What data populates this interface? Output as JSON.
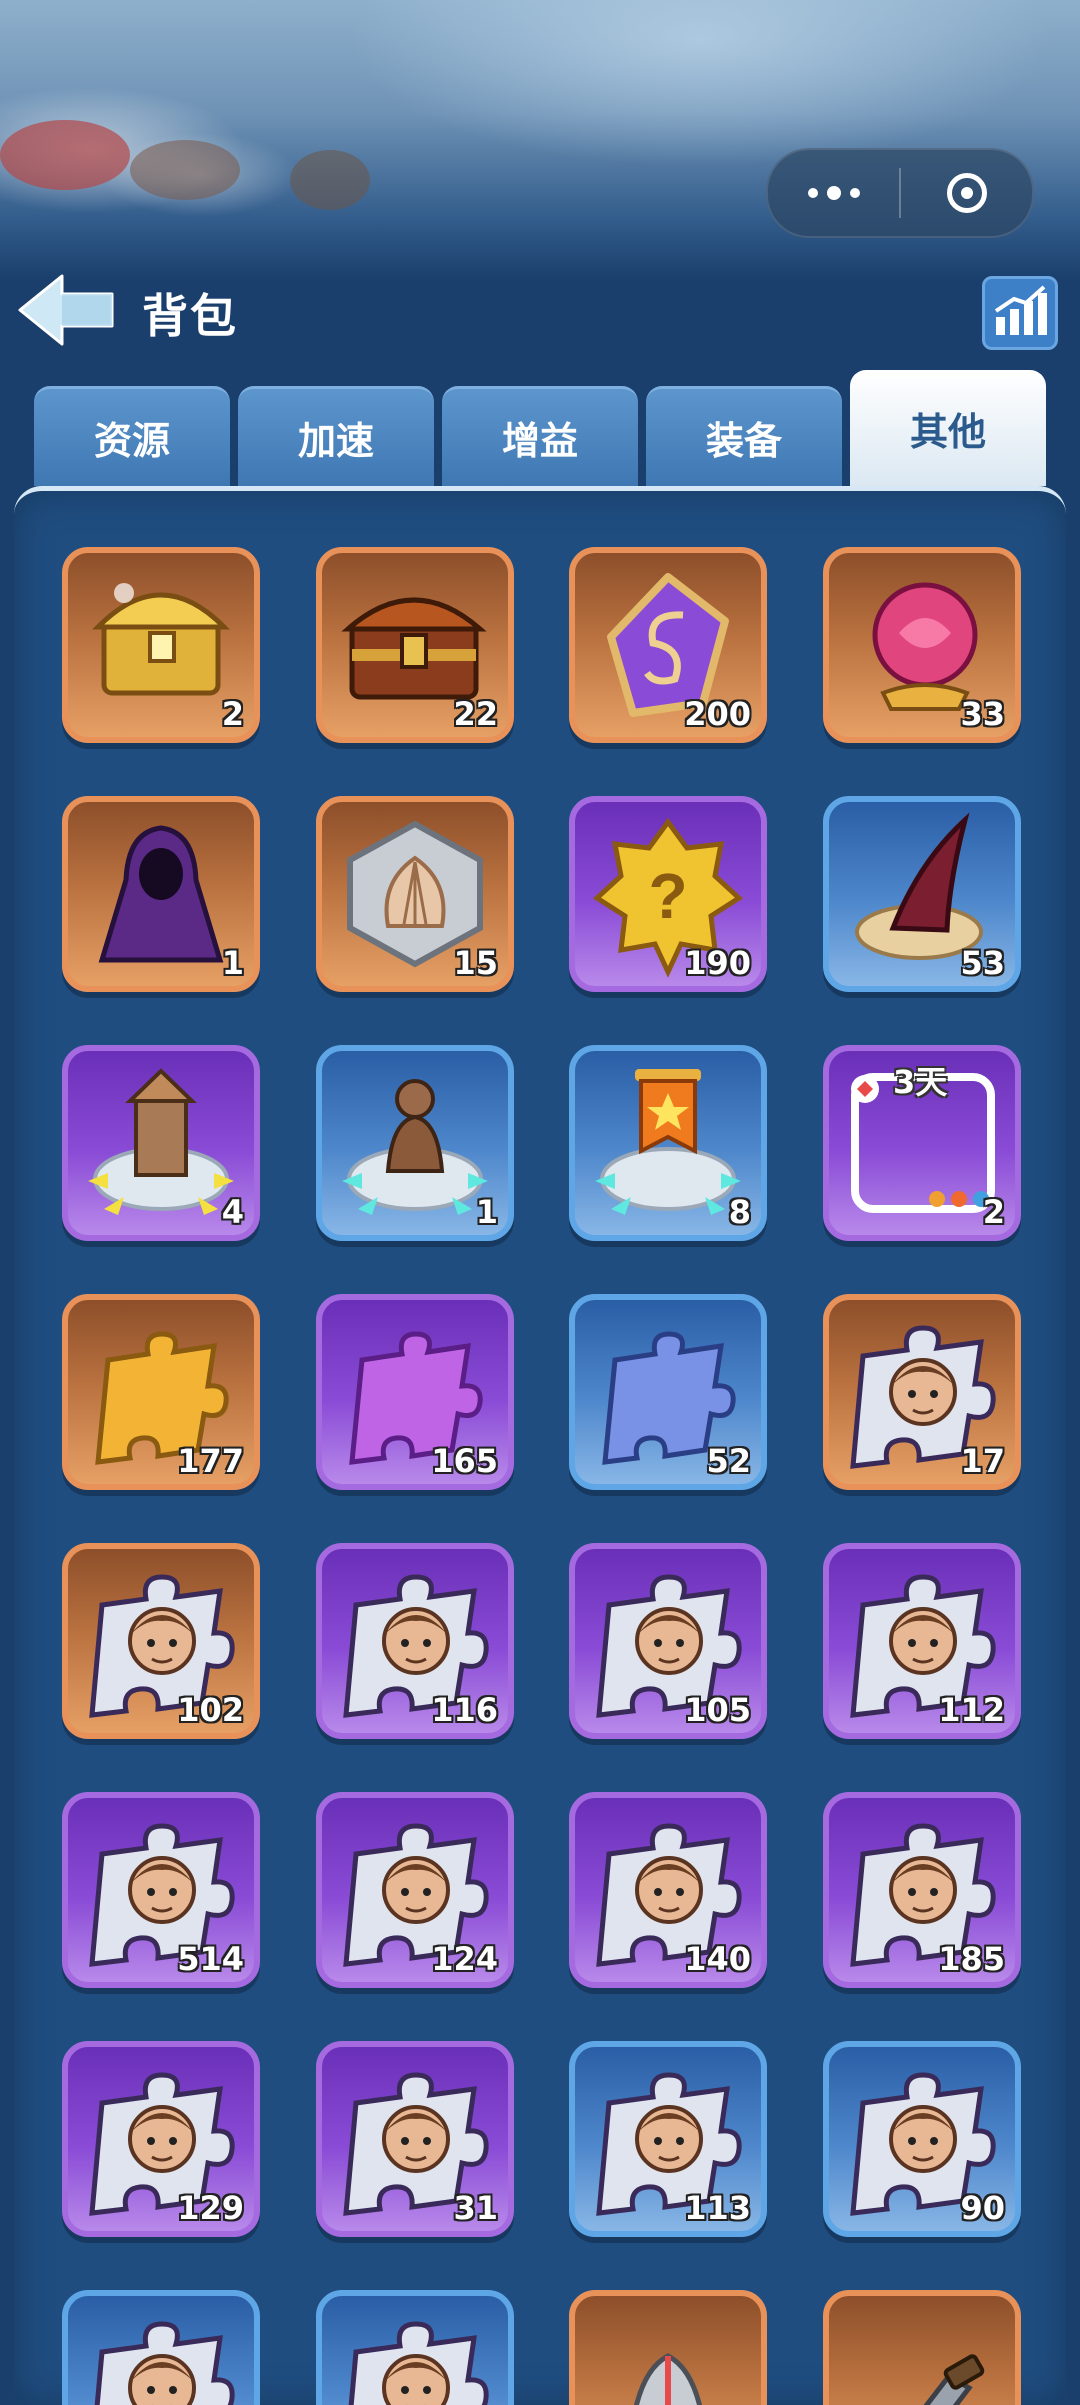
{
  "header": {
    "title": "背包",
    "back_icon": "back-arrow-icon",
    "stats_icon": "bar-chart-icon"
  },
  "capsule": {
    "more_icon": "more-dots-icon",
    "close_icon": "target-close-icon"
  },
  "tabs": [
    {
      "label": "资源",
      "active": false
    },
    {
      "label": "加速",
      "active": false
    },
    {
      "label": "增益",
      "active": false
    },
    {
      "label": "装备",
      "active": false
    },
    {
      "label": "其他",
      "active": true
    }
  ],
  "colors": {
    "orange": "#e8925a",
    "purple": "#a56ae0",
    "blue": "#5fa6e6",
    "panel": "#1f4d80"
  },
  "items": [
    {
      "icon": "gold-treasure-chest-icon",
      "count": "2",
      "rarity": "orange"
    },
    {
      "icon": "wooden-treasure-chest-icon",
      "count": "22",
      "rarity": "orange"
    },
    {
      "icon": "purple-rune-stone-icon",
      "count": "200",
      "rarity": "orange"
    },
    {
      "icon": "pink-rose-gem-icon",
      "count": "33",
      "rarity": "orange"
    },
    {
      "icon": "hooded-cloak-icon",
      "count": "1",
      "rarity": "orange"
    },
    {
      "icon": "shell-token-icon",
      "count": "15",
      "rarity": "orange"
    },
    {
      "icon": "mystery-badge-icon",
      "count": "190",
      "rarity": "purple"
    },
    {
      "icon": "horn-nest-icon",
      "count": "53",
      "rarity": "blue"
    },
    {
      "icon": "tower-relocation-icon",
      "count": "4",
      "rarity": "purple"
    },
    {
      "icon": "statue-relocation-icon",
      "count": "1",
      "rarity": "blue"
    },
    {
      "icon": "banner-relocation-icon",
      "count": "8",
      "rarity": "blue"
    },
    {
      "icon": "avatar-frame-icon",
      "count": "2",
      "rarity": "purple",
      "days": "3天"
    },
    {
      "icon": "gold-puzzle-piece-icon",
      "count": "177",
      "rarity": "orange"
    },
    {
      "icon": "purple-puzzle-piece-icon",
      "count": "165",
      "rarity": "purple"
    },
    {
      "icon": "blue-puzzle-piece-icon",
      "count": "52",
      "rarity": "blue"
    },
    {
      "icon": "hero-puzzle-piece-icon",
      "count": "17",
      "rarity": "orange"
    },
    {
      "icon": "hero-puzzle-piece-icon",
      "count": "102",
      "rarity": "orange"
    },
    {
      "icon": "hero-puzzle-piece-icon",
      "count": "116",
      "rarity": "purple"
    },
    {
      "icon": "hero-puzzle-piece-icon",
      "count": "105",
      "rarity": "purple"
    },
    {
      "icon": "hero-puzzle-piece-icon",
      "count": "112",
      "rarity": "purple"
    },
    {
      "icon": "hero-puzzle-piece-icon",
      "count": "514",
      "rarity": "purple"
    },
    {
      "icon": "hero-puzzle-piece-icon",
      "count": "124",
      "rarity": "purple"
    },
    {
      "icon": "hero-puzzle-piece-icon",
      "count": "140",
      "rarity": "purple"
    },
    {
      "icon": "hero-puzzle-piece-icon",
      "count": "185",
      "rarity": "purple"
    },
    {
      "icon": "hero-puzzle-piece-icon",
      "count": "129",
      "rarity": "purple"
    },
    {
      "icon": "hero-puzzle-piece-icon",
      "count": "31",
      "rarity": "purple"
    },
    {
      "icon": "hero-puzzle-piece-icon",
      "count": "113",
      "rarity": "blue"
    },
    {
      "icon": "hero-puzzle-piece-icon",
      "count": "90",
      "rarity": "blue"
    },
    {
      "icon": "hero-puzzle-piece-icon",
      "count": "",
      "rarity": "blue"
    },
    {
      "icon": "hero-puzzle-piece-icon",
      "count": "",
      "rarity": "blue"
    },
    {
      "icon": "helmet-icon",
      "count": "",
      "rarity": "orange"
    },
    {
      "icon": "weapon-icon",
      "count": "",
      "rarity": "orange"
    }
  ]
}
